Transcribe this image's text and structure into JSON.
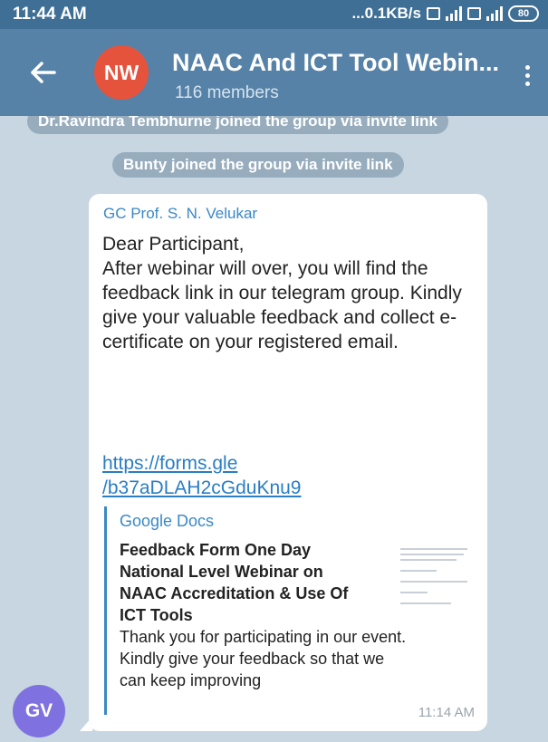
{
  "status_bar": {
    "time": "11:44 AM",
    "network_speed": "...0.1KB/s",
    "battery": "80"
  },
  "header": {
    "avatar_initials": "NW",
    "title": "NAAC And ICT Tool Webin...",
    "subtitle": "116 members"
  },
  "service_messages": [
    "Dr.Ravindra Tembhurne joined the group via invite link",
    "Bunty joined the group via invite link"
  ],
  "message": {
    "sender": "GC Prof. S. N. Velukar",
    "text": {
      "line1": "Dear Participant,",
      "line2": "After webinar will over, you will find the feedback link in our telegram group. Kindly give your valuable feedback and collect e-certificate on your registered email."
    },
    "link": {
      "line1": "https://forms.gle",
      "line2": "/b37aDLAH2cGduKnu9"
    },
    "preview": {
      "site": "Google Docs",
      "title": {
        "line1": "Feedback Form One Day",
        "line2": "National Level Webinar on",
        "line3": "NAAC Accreditation & Use Of",
        "line4": "ICT Tools"
      },
      "description": {
        "line1": "Thank you for participating in our event.",
        "line2": "Kindly give your feedback so that we",
        "line3": "can keep improving"
      }
    },
    "time": "11:14 AM",
    "sender_avatar": "GV"
  },
  "colors": {
    "status_bar": "#3f6f95",
    "app_bar": "#5682a8",
    "chat_background": "#c7d6e0",
    "avatar_nw": "#e5533d",
    "avatar_gv": "#7f72e0",
    "link": "#2a7ec3",
    "sender_name": "#3a88c6"
  },
  "icons": {
    "back": "back-arrow-icon",
    "menu": "more-vertical-icon"
  }
}
